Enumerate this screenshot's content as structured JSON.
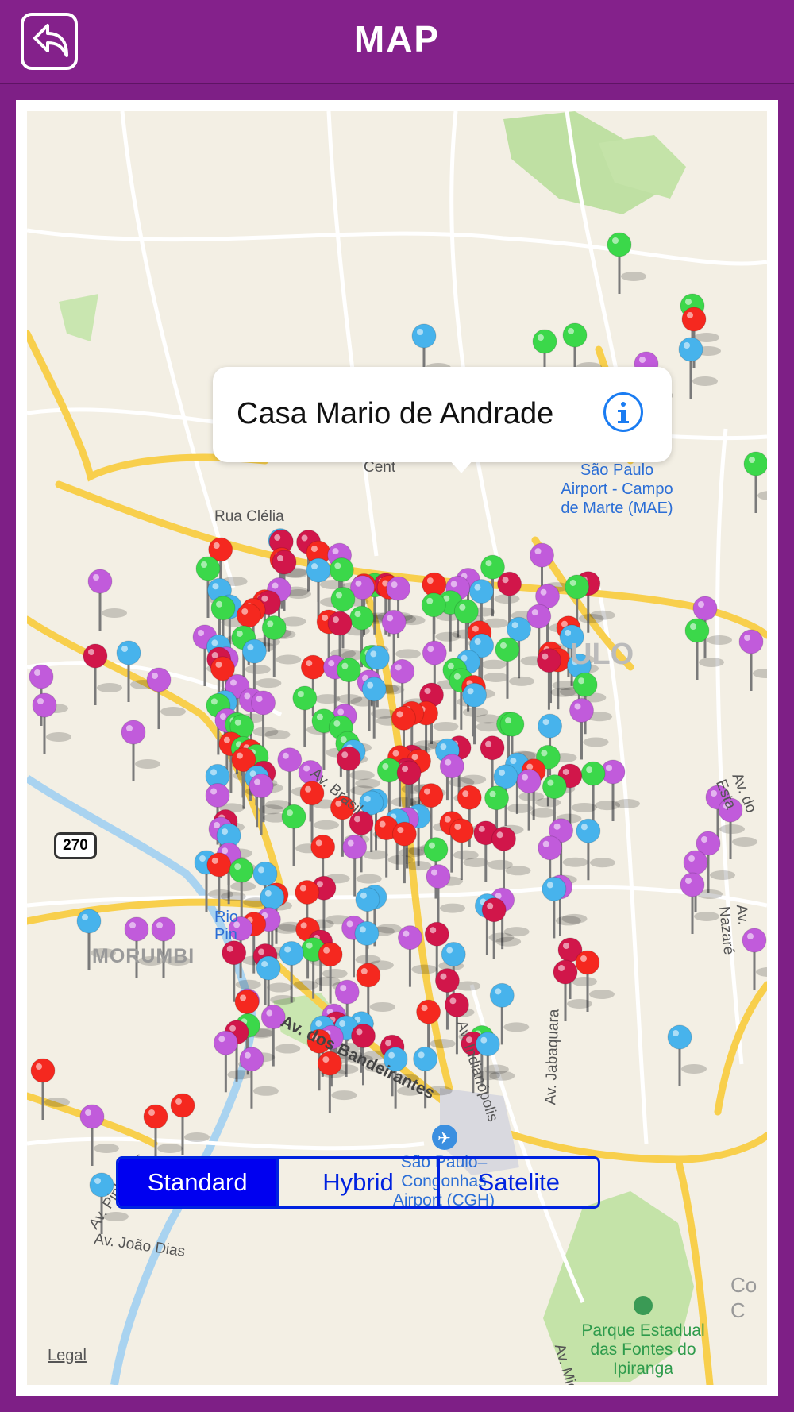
{
  "header": {
    "title": "MAP",
    "back_icon": "back-arrow-icon"
  },
  "callout": {
    "title": "Casa Mario de Andrade",
    "info_icon": "info-icon"
  },
  "map_type": {
    "options": [
      "Standard",
      "Hybrid",
      "Satelite"
    ],
    "selected": "Standard"
  },
  "legal_label": "Legal",
  "map_labels": {
    "airport_mae": "São Paulo Airport - Campo de Marte (MAE)",
    "airport_mae_l1": "São Paulo",
    "airport_mae_l2": "Airport - Campo",
    "airport_mae_l3": "de Marte (MAE)",
    "rua_clelia": "Rua Clélia",
    "paulo": "ULO",
    "morumbi": "MORUMBI",
    "route_270": "270",
    "av_brasil": "Av. Brasil",
    "av_bandeirantes": "Av. dos Bandeirantes",
    "av_indianopolis": "Av. Indianópolis",
    "av_jabaquara": "Av. Jabaquara",
    "av_nazare": "Av. Nazaré",
    "av_do_estado": "Av. do Esta",
    "av_joao_dias": "Av. João Dias",
    "av_miguel_estefano": "Av. Miguel Estéfano",
    "airport_cgh_l1": "São Paulo–",
    "airport_cgh_l2": "Congonhas",
    "airport_cgh_l3": "Airport (CGH)",
    "parque_l1": "Parque Estadual",
    "parque_l2": "das Fontes do",
    "parque_l3": "Ipiranga",
    "rio_pin": "Rio",
    "rio_pin2": "Pin",
    "centro": "Cent",
    "av_pinheiros": "Av. Pinheiros",
    "cor": "Co",
    "cor2": "C"
  },
  "pin_colors": {
    "red": "#f5281f",
    "green": "#3bd84a",
    "purple": "#c15bdb",
    "blue": "#47b3ec",
    "crimson": "#d1164a"
  },
  "colors": {
    "header_bg": "#84218b",
    "map_bg": "#f3efe4",
    "road_major": "#f8cf4c",
    "accent_blue": "#0022e0"
  }
}
